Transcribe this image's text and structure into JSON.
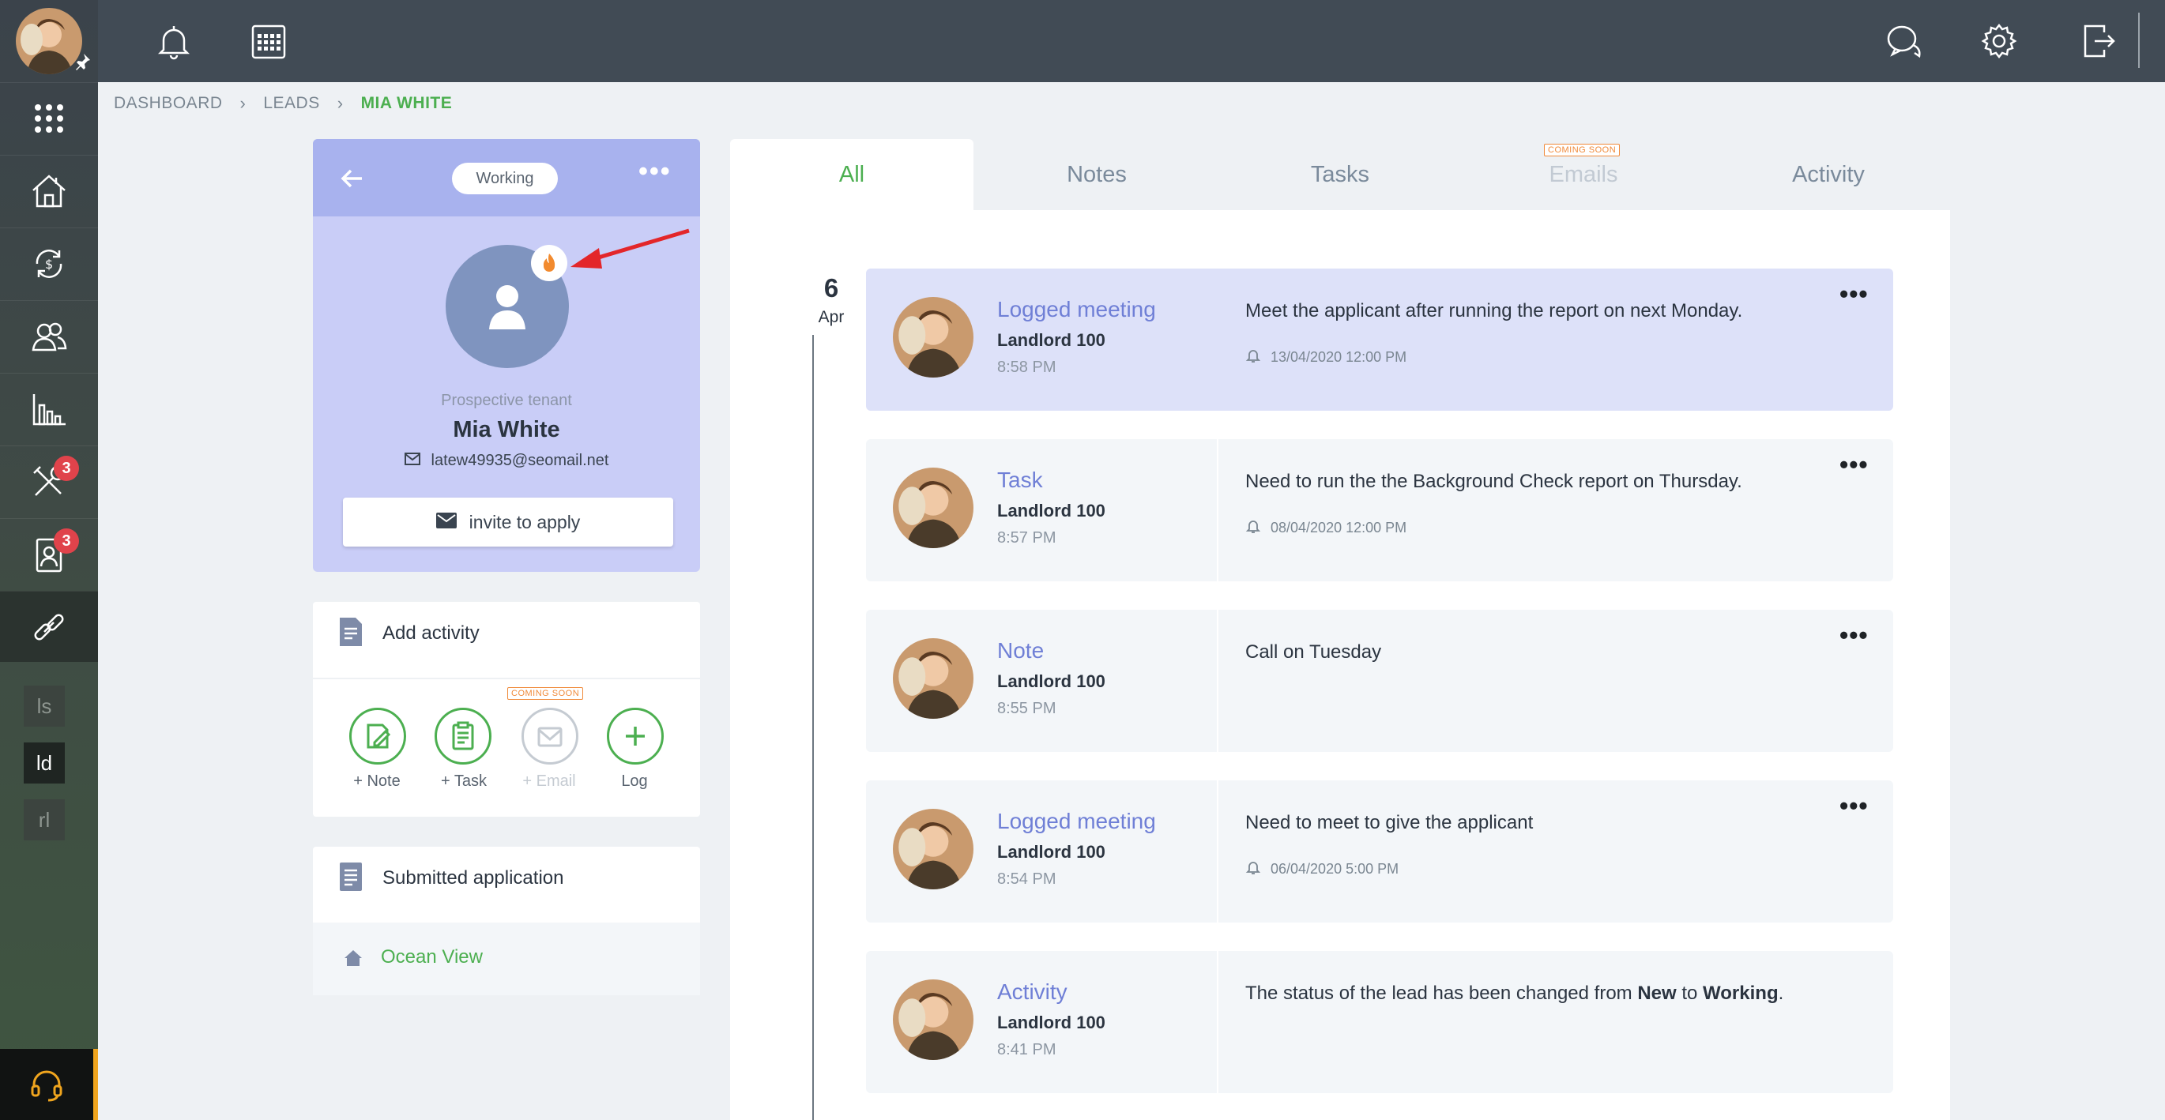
{
  "sidebar": {
    "nav_icons": [
      "apps-grid-icon",
      "property-house-icon",
      "finance-exchange-icon",
      "tenants-people-icon",
      "reports-chart-icon",
      "maintenance-tools-icon",
      "applications-icon",
      "links-icon"
    ],
    "maintenance_badge": "3",
    "applications_badge": "3",
    "shortcuts": [
      "ls",
      "ld",
      "rl"
    ]
  },
  "topbar": {
    "icons": [
      "bell-icon",
      "calendar-icon",
      "chat-icon",
      "gear-icon",
      "logout-icon"
    ]
  },
  "breadcrumb": {
    "items": [
      "DASHBOARD",
      "LEADS"
    ],
    "current": "MIA WHITE"
  },
  "lead": {
    "status": "Working",
    "role": "Prospective tenant",
    "name": "Mia White",
    "email": "latew49935@seomail.net",
    "invite_label": "invite to apply"
  },
  "add_activity": {
    "title": "Add activity",
    "coming_soon": "COMING SOON",
    "actions": [
      {
        "label": "+ Note",
        "icon": "note-icon",
        "enabled": true
      },
      {
        "label": "+ Task",
        "icon": "task-clipboard-icon",
        "enabled": true
      },
      {
        "label": "+ Email",
        "icon": "email-icon",
        "enabled": false
      },
      {
        "label": "Log",
        "icon": "plus-icon",
        "enabled": true
      }
    ]
  },
  "submitted": {
    "title": "Submitted application",
    "property": "Ocean View"
  },
  "tabs": {
    "all": "All",
    "notes": "Notes",
    "tasks": "Tasks",
    "emails": "Emails",
    "emails_badge": "COMING SOON",
    "activity": "Activity"
  },
  "timeline": {
    "day": "6",
    "month": "Apr",
    "entries": [
      {
        "type": "Logged meeting",
        "author": "Landlord 100",
        "time": "8:58 PM",
        "text": "Meet the applicant after running the report on next Monday.",
        "reminder": "13/04/2020 12:00 PM"
      },
      {
        "type": "Task",
        "author": "Landlord 100",
        "time": "8:57 PM",
        "text": "Need to run the the Background Check report on Thursday.",
        "reminder": "08/04/2020 12:00 PM"
      },
      {
        "type": "Note",
        "author": "Landlord 100",
        "time": "8:55 PM",
        "text": "Call on Tuesday",
        "reminder": ""
      },
      {
        "type": "Logged meeting",
        "author": "Landlord 100",
        "time": "8:54 PM",
        "text": "Need to meet to give the applicant",
        "reminder": "06/04/2020 5:00 PM"
      },
      {
        "type": "Activity",
        "author": "Landlord 100",
        "time": "8:41 PM",
        "text_prefix": "The status of the lead has been changed from ",
        "text_from": "New",
        "text_mid": " to ",
        "text_to": "Working",
        "text_suffix": "."
      }
    ]
  },
  "colors": {
    "accent_green": "#4caf50",
    "lead_card": "#c9cdf7",
    "timeline_link": "#6f7fd6",
    "badge_red": "#e0434b",
    "coming_soon_orange": "#f08a3a"
  }
}
